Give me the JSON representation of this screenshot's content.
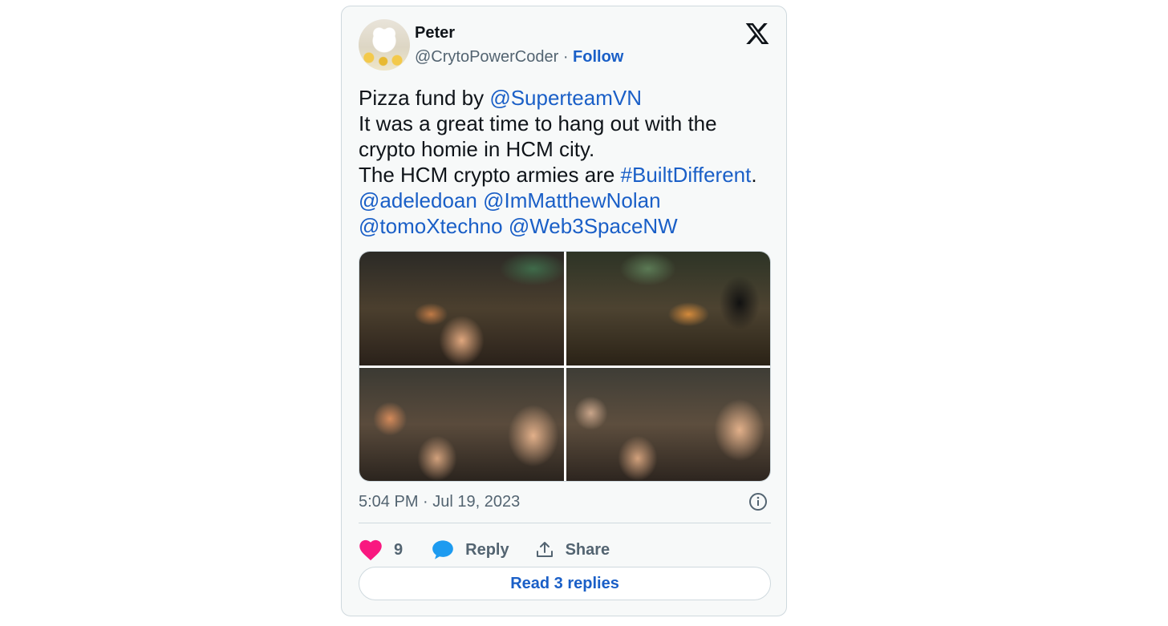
{
  "tweet": {
    "author_name": "Peter",
    "author_handle": "@CrytoPowerCoder",
    "separator": "·",
    "follow_label": "Follow",
    "text_parts": [
      {
        "text": "Pizza fund by ",
        "link": false
      },
      {
        "text": "@SuperteamVN",
        "link": true
      },
      {
        "text": "\nIt was a great time to hang out with the crypto homie in HCM city.\nThe HCM crypto armies are ",
        "link": false
      },
      {
        "text": "#BuiltDifferent",
        "link": true
      },
      {
        "text": ".\n",
        "link": false
      },
      {
        "text": "@adeledoan",
        "link": true
      },
      {
        "text": " ",
        "link": false
      },
      {
        "text": "@ImMatthewNolan",
        "link": true
      },
      {
        "text": "\n",
        "link": false
      },
      {
        "text": "@tomoXtechno",
        "link": true
      },
      {
        "text": " ",
        "link": false
      },
      {
        "text": "@Web3SpaceNW",
        "link": true
      }
    ],
    "media": [
      {
        "icon": "photo-group-selfie"
      },
      {
        "icon": "photo-pizza-table"
      },
      {
        "icon": "photo-group-selfie-2"
      },
      {
        "icon": "photo-group-selfie-3"
      }
    ],
    "timestamp": "5:04 PM · Jul 19, 2023",
    "like_count": "9",
    "reply_label": "Reply",
    "share_label": "Share",
    "read_replies_label": "Read 3 replies"
  },
  "colors": {
    "accent": "#1a5fc7",
    "like": "#f91880",
    "reply": "#1d9bf0",
    "muted": "#536471",
    "card_bg": "#f7f9f9",
    "border": "#cfd9de"
  },
  "icons": {
    "brand": "x-logo-icon",
    "info": "info-icon",
    "like": "heart-icon",
    "reply": "speech-bubble-icon",
    "share": "share-upload-icon"
  }
}
